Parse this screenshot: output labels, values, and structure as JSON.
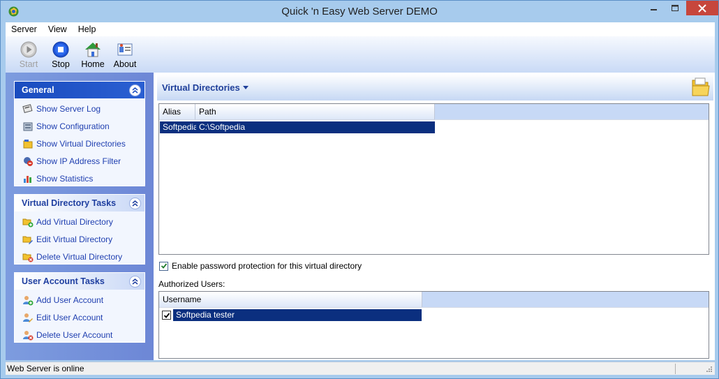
{
  "window": {
    "title": "Quick 'n Easy Web Server DEMO",
    "accent": "#1a4cbf",
    "selection_color": "#0b2f7f"
  },
  "menu": {
    "items": [
      "Server",
      "View",
      "Help"
    ]
  },
  "toolbar": {
    "buttons": [
      {
        "label": "Start",
        "icon": "play-icon",
        "enabled": false
      },
      {
        "label": "Stop",
        "icon": "stop-icon",
        "enabled": true
      },
      {
        "label": "Home",
        "icon": "home-icon",
        "enabled": true
      },
      {
        "label": "About",
        "icon": "about-icon",
        "enabled": true
      }
    ]
  },
  "sidebar": {
    "groups": [
      {
        "title": "General",
        "items": [
          {
            "label": "Show Server Log",
            "icon": "server-log-icon"
          },
          {
            "label": "Show Configuration",
            "icon": "configuration-icon"
          },
          {
            "label": "Show Virtual Directories",
            "icon": "folder-icon"
          },
          {
            "label": "Show IP Address Filter",
            "icon": "ip-filter-icon"
          },
          {
            "label": "Show Statistics",
            "icon": "statistics-icon"
          }
        ]
      },
      {
        "title": "Virtual Directory Tasks",
        "items": [
          {
            "label": "Add Virtual Directory",
            "icon": "folder-add-icon"
          },
          {
            "label": "Edit Virtual Directory",
            "icon": "folder-edit-icon"
          },
          {
            "label": "Delete Virtual Directory",
            "icon": "folder-delete-icon"
          }
        ]
      },
      {
        "title": "User Account Tasks",
        "items": [
          {
            "label": "Add User Account",
            "icon": "user-add-icon"
          },
          {
            "label": "Edit User Account",
            "icon": "user-edit-icon"
          },
          {
            "label": "Delete User Account",
            "icon": "user-delete-icon"
          }
        ]
      }
    ]
  },
  "main": {
    "title": "Virtual Directories",
    "vdir_table": {
      "columns": [
        "Alias",
        "Path"
      ],
      "rows": [
        {
          "alias": "Softpedia",
          "path": "C:\\Softpedia",
          "selected": true
        }
      ]
    },
    "password_protection": {
      "label": "Enable password protection for this virtual directory",
      "checked": true
    },
    "authorized_users_label": "Authorized Users:",
    "users_table": {
      "columns": [
        "Username"
      ],
      "rows": [
        {
          "username": "Softpedia tester",
          "checked": true,
          "selected": true
        }
      ]
    }
  },
  "status": {
    "text": "Web Server is online"
  }
}
